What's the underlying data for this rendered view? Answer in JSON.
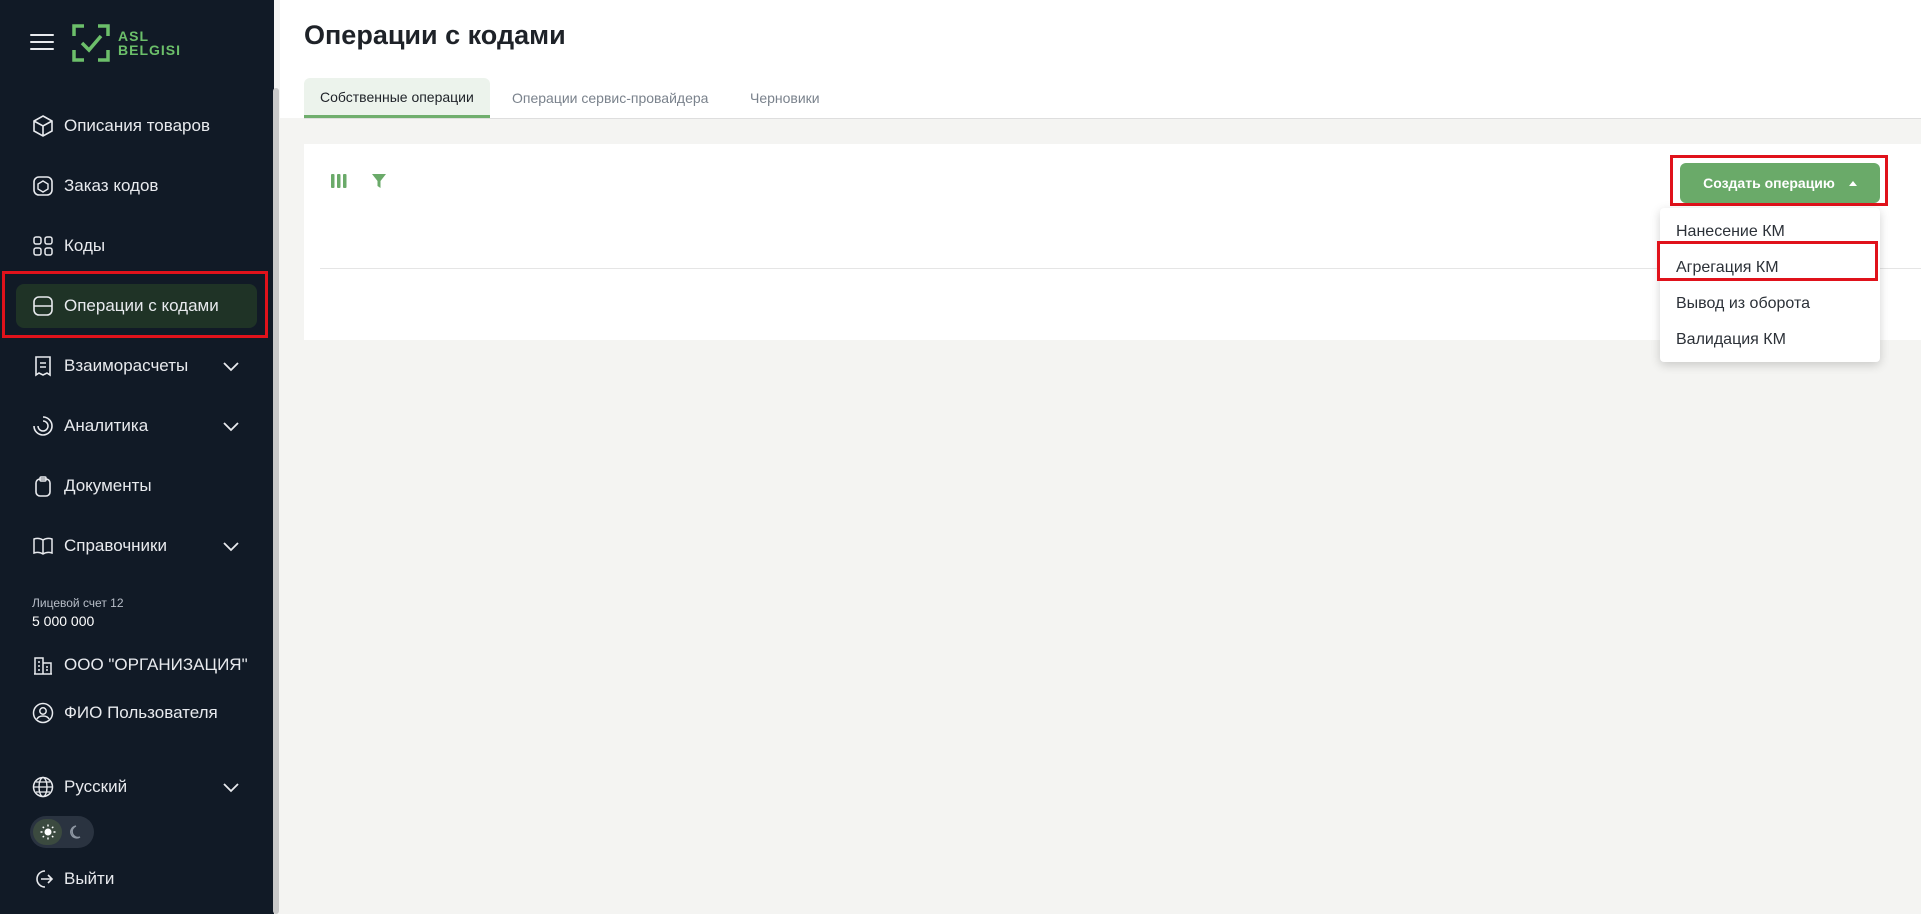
{
  "app": {
    "logo_line1": "ASL",
    "logo_line2": "BELGISI"
  },
  "sidebar": {
    "items": [
      {
        "label": "Описания товаров",
        "icon": "box-icon"
      },
      {
        "label": "Заказ кодов",
        "icon": "box-order-icon"
      },
      {
        "label": "Коды",
        "icon": "codes-icon"
      },
      {
        "label": "Операции с кодами",
        "icon": "operations-icon",
        "active": true
      },
      {
        "label": "Взаиморасчеты",
        "icon": "receipt-icon",
        "expandable": true
      },
      {
        "label": "Аналитика",
        "icon": "analytics-icon",
        "expandable": true
      },
      {
        "label": "Документы",
        "icon": "clipboard-icon"
      },
      {
        "label": "Справочники",
        "icon": "book-icon",
        "expandable": true
      }
    ],
    "account": {
      "label": "Лицевой счет 12",
      "value": "5 000 000"
    },
    "organization": "ООО \"ОРГАНИЗАЦИЯ\"",
    "user": "ФИО Пользователя",
    "language": "Русский",
    "logout": "Выйти"
  },
  "main": {
    "title": "Операции с кодами",
    "tabs": [
      {
        "label": "Собственные операции",
        "active": true
      },
      {
        "label": "Операции сервис-провайдера"
      },
      {
        "label": "Черновики"
      }
    ],
    "create_button": "Создать операцию",
    "dropdown": [
      "Нанесение КМ",
      "Агрегация КМ",
      "Вывод из оборота",
      "Валидация КМ"
    ]
  },
  "colors": {
    "sidebar_bg": "#111a26",
    "accent": "#6aaa69",
    "highlight": "#e0121b"
  }
}
